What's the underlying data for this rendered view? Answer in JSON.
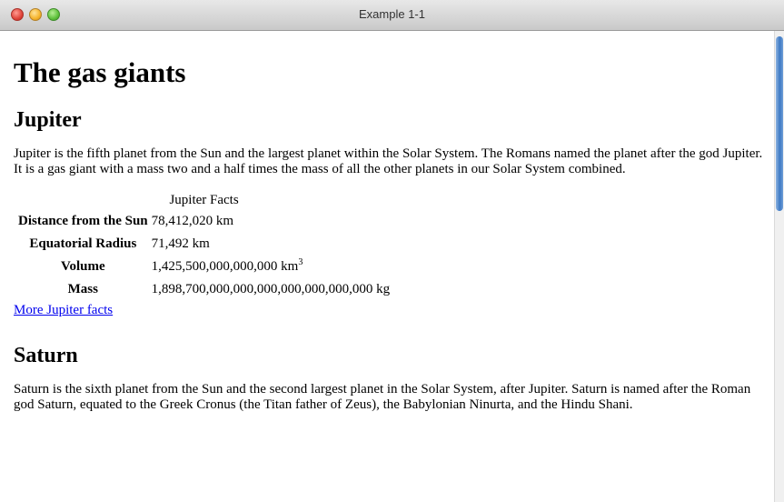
{
  "window": {
    "title": "Example 1-1"
  },
  "page": {
    "title": "The gas giants"
  },
  "jupiter": {
    "heading": "Jupiter",
    "text": "Jupiter is the fifth planet from the Sun and the largest planet within the Solar System. The Romans named the planet after the god Jupiter. It is a gas giant with a mass two and a half times the mass of all the other planets in our Solar System combined.",
    "table": {
      "caption": "Jupiter Facts",
      "rows": [
        {
          "label": "Distance from the Sun",
          "value": "78,412,020 km"
        },
        {
          "label": "Equatorial Radius",
          "value": "71,492 km"
        },
        {
          "label": "Volume",
          "value": "1,425,500,000,000,000 km",
          "superscript": "3"
        },
        {
          "label": "Mass",
          "value": "1,898,700,000,000,000,000,000,000,000 kg"
        }
      ]
    },
    "more_link": "More Jupiter facts"
  },
  "saturn": {
    "heading": "Saturn",
    "text": "Saturn is the sixth planet from the Sun and the second largest planet in the Solar System, after Jupiter. Saturn is named after the Roman god Saturn, equated to the Greek Cronus (the Titan father of Zeus), the Babylonian Ninurta, and the Hindu Shani."
  },
  "icons": {
    "close": "close-button-icon",
    "minimize": "minimize-button-icon",
    "zoom": "zoom-button-icon"
  },
  "colors": {
    "link": "#0000ee",
    "scroll_thumb": "#3d79c4"
  }
}
